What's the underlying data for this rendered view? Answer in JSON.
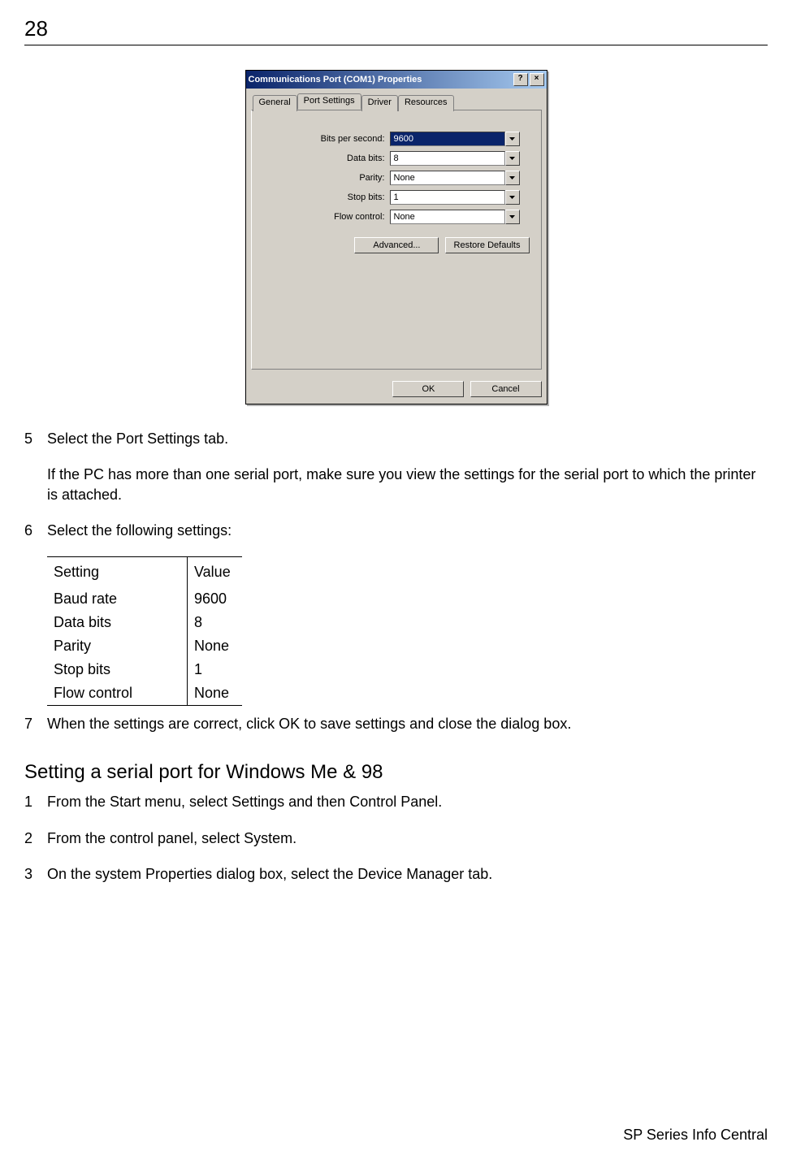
{
  "page_number": "28",
  "dialog": {
    "title": "Communications Port (COM1) Properties",
    "help_btn": "?",
    "close_btn": "×",
    "tabs": [
      "General",
      "Port Settings",
      "Driver",
      "Resources"
    ],
    "active_tab_index": 1,
    "fields": {
      "bits_per_second": {
        "label": "Bits per second:",
        "value": "9600"
      },
      "data_bits": {
        "label": "Data bits:",
        "value": "8"
      },
      "parity": {
        "label": "Parity:",
        "value": "None"
      },
      "stop_bits": {
        "label": "Stop bits:",
        "value": "1"
      },
      "flow_control": {
        "label": "Flow control:",
        "value": "None"
      }
    },
    "advanced_btn": "Advanced...",
    "restore_btn": "Restore Defaults",
    "ok_btn": "OK",
    "cancel_btn": "Cancel"
  },
  "steps": {
    "s5_num": "5",
    "s5_text": "Select the Port Settings tab.",
    "s5_note": "If the PC has more than one serial port, make sure you view the settings for the serial port to which the printer is attached.",
    "s6_num": "6",
    "s6_text": "Select the following settings:",
    "s7_num": "7",
    "s7_text": "When the settings are correct, click OK to save settings and close the dialog box."
  },
  "settings_table": {
    "header": {
      "c1": "Setting",
      "c2": "Value"
    },
    "rows": [
      {
        "c1": "Baud rate",
        "c2": "9600"
      },
      {
        "c1": "Data bits",
        "c2": "8"
      },
      {
        "c1": "Parity",
        "c2": "None"
      },
      {
        "c1": "Stop bits",
        "c2": "1"
      },
      {
        "c1": "Flow control",
        "c2": "None"
      }
    ]
  },
  "section_heading": "Setting a serial port for Windows Me & 98",
  "steps2": {
    "s1_num": "1",
    "s1_text": "From the Start menu, select Settings and then Control Panel.",
    "s2_num": "2",
    "s2_text": "From the control panel, select System.",
    "s3_num": "3",
    "s3_text": "On the system Properties dialog box, select the Device Manager tab."
  },
  "footer": "SP Series Info Central"
}
